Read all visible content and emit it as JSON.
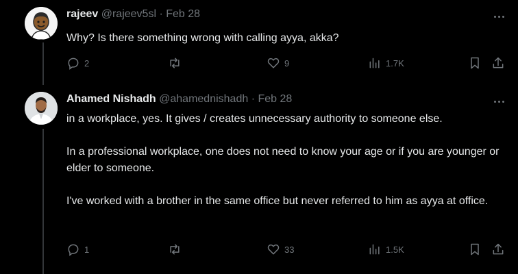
{
  "tweets": [
    {
      "name": "rajeev",
      "handle": "@rajeev5sl",
      "separator": "·",
      "date": "Feb 28",
      "text": [
        "Why? Is there something wrong with calling ayya, akka?"
      ],
      "replies": "2",
      "retweets": "",
      "likes": "9",
      "views": "1.7K"
    },
    {
      "name": "Ahamed Nishadh",
      "handle": "@ahamednishadh",
      "separator": "·",
      "date": "Feb 28",
      "text": [
        "in a workplace, yes. It gives / creates unnecessary authority to someone else.",
        "In a professional workplace, one does not need to know your age or if you are younger or elder to someone.",
        "I've worked with a brother in the same office but never referred to him as ayya at office."
      ],
      "replies": "1",
      "retweets": "",
      "likes": "33",
      "views": "1.5K"
    }
  ],
  "icons": {
    "reply": "reply-icon",
    "retweet": "retweet-icon",
    "like": "heart-icon",
    "views": "views-icon",
    "bookmark": "bookmark-icon",
    "share": "share-icon",
    "more": "more-icon"
  },
  "colors": {
    "background": "#000000",
    "text": "#e7e9ea",
    "muted": "#71767b",
    "thread_line": "#333639"
  }
}
